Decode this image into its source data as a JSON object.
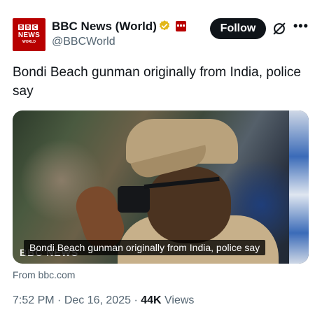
{
  "account": {
    "avatar_blocks": [
      "B",
      "B",
      "C"
    ],
    "avatar_line1": "NEWS",
    "avatar_line2": "WORLD",
    "name": "BBC News (World)",
    "handle": "@BBCWorld",
    "verified_badge_color": "#e2b719",
    "brand_color": "#b80000"
  },
  "actions": {
    "follow_label": "Follow",
    "grok_icon": "grok-slash-icon",
    "more_label": "•••"
  },
  "tweet": {
    "text": "Bondi Beach gunman originally from India, police say",
    "media_caption": "Bondi Beach gunman originally from India, police say",
    "media_watermark": "BBC NEWS",
    "from_label": "From bbc.com",
    "time": "7:52 PM",
    "separator": " · ",
    "date": "Dec 16, 2025",
    "views_count": "44K",
    "views_label": "Views"
  }
}
